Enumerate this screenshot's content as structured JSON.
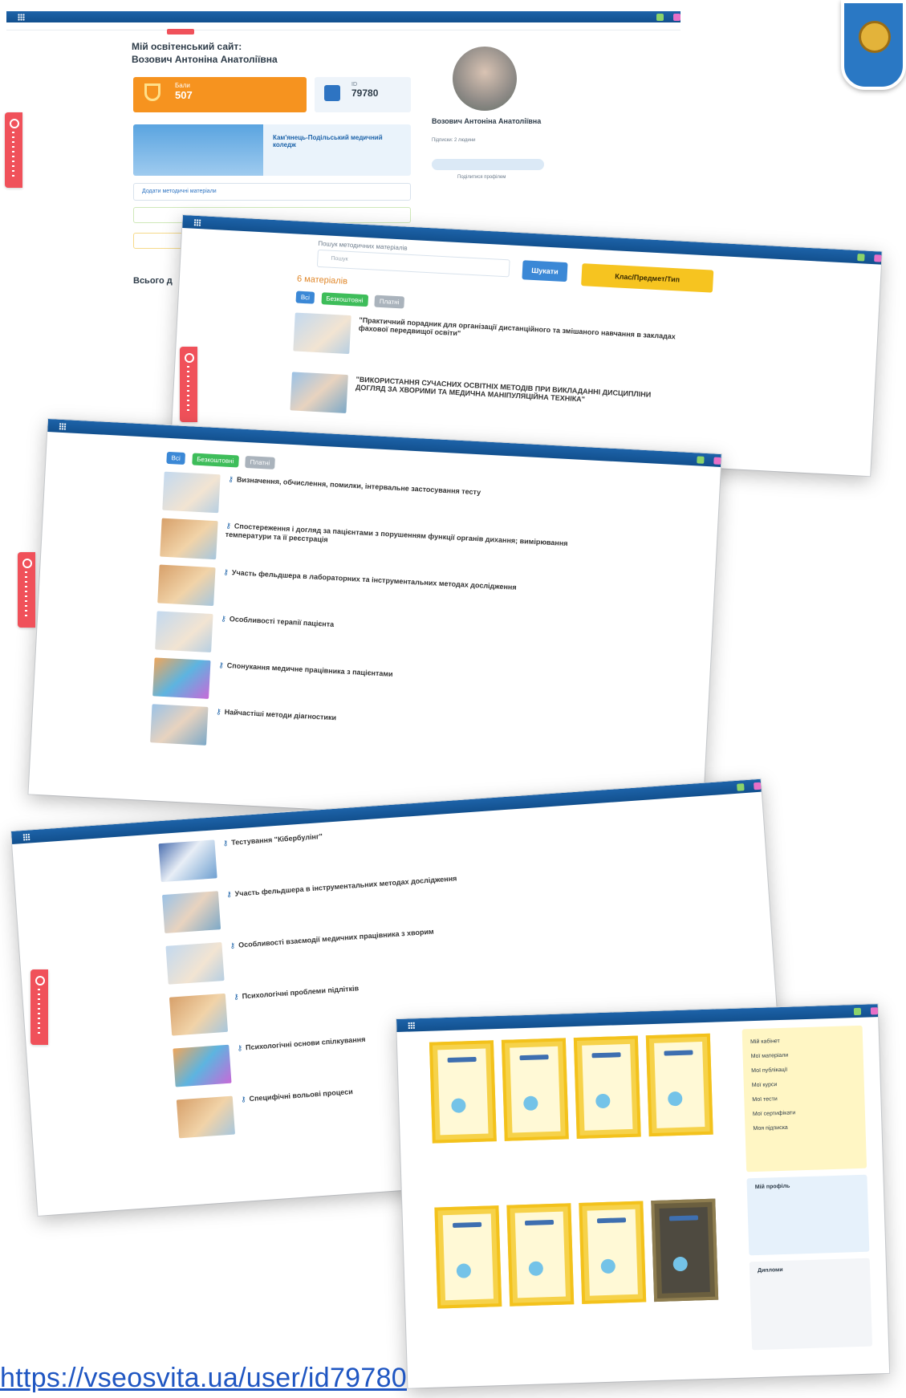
{
  "profile_page": {
    "site_title_line1": "Мій освітенський сайт:",
    "site_title_line2": "Возович Антоніна Анатоліївна",
    "points_label": "Бали",
    "points_value": "507",
    "id_label": "ID",
    "id_value": "79780",
    "college_name": "Кам'янець-Подільський медичний коледж",
    "add_material_placeholder": "Додати методичні матеріали",
    "total_label": "Всього д",
    "user_name": "Возович Антоніна Анатоліївна",
    "followers": "Підписки: 2 людини",
    "share_label": "Поділитися профілем"
  },
  "search_page": {
    "section_title": "Пошук методичних матеріалів",
    "search_placeholder": "Пошук",
    "search_button": "Шукати",
    "filter_button": "Клас/Предмет/Тип",
    "count_label": "6 матеріалів",
    "tab_all": "Всі",
    "tab_free": "Безкоштовні",
    "tab_paid": "Платні",
    "items": [
      {
        "title": "\"Практичний порадник для організації дистанційного та змішаного навчання в закладах фахової передвищої освіти\""
      },
      {
        "title": "\"ВИКОРИСТАННЯ СУЧАСНИХ ОСВІТНІХ МЕТОДІВ ПРИ ВИКЛАДАННІ ДИСЦИПЛІНИ ДОГЛЯД ЗА ХВОРИМИ ТА МЕДИЧНА МАНІПУЛЯЦІЙНА ТЕХНІКА\""
      }
    ]
  },
  "list_page": {
    "tab_all": "Всі",
    "tab_free": "Безкоштовні",
    "tab_paid": "Платні",
    "items": [
      {
        "title": "Визначення, обчислення, помилки, інтервальне застосування тесту"
      },
      {
        "title": "Спостереження і догляд за пацієнтами з порушенням функції органів дихання; вимірювання температури та її реєстрація"
      },
      {
        "title": "Участь фельдшера в лабораторних та інструментальних методах дослідження"
      },
      {
        "title": "Особливості терапії пацієнта"
      },
      {
        "title": "Спонукання медичне працівника з пацієнтами"
      },
      {
        "title": "Найчастіші методи діагностики"
      }
    ]
  },
  "tests_page": {
    "items": [
      {
        "title": "Тестування \"Кібербулінг\""
      },
      {
        "title": "Участь фельдшера в інструментальних методах дослідження"
      },
      {
        "title": "Особливості взаємодії медичних працівника з хворим"
      },
      {
        "title": "Психологічні проблеми підлітків"
      },
      {
        "title": "Психологічні основи спілкування"
      },
      {
        "title": "Специфічні вольові процеси"
      }
    ]
  },
  "certificates_page": {
    "sidebar_items": [
      "Мій кабінет",
      "Мої матеріали",
      "Мої публікації",
      "Мої курси",
      "Мої тести",
      "Мої сертифікати",
      "Моя підписка"
    ],
    "sidebar_block2_title": "Мій профіль",
    "sidebar_block3_title": "Дипломи"
  },
  "profile_url": "https://vseosvita.ua/user/id79780",
  "colors": {
    "nav": "#1d63a9",
    "accent_orange": "#f6931f",
    "accent_red": "#f0515a",
    "yellow_cert": "#f6d24a"
  }
}
